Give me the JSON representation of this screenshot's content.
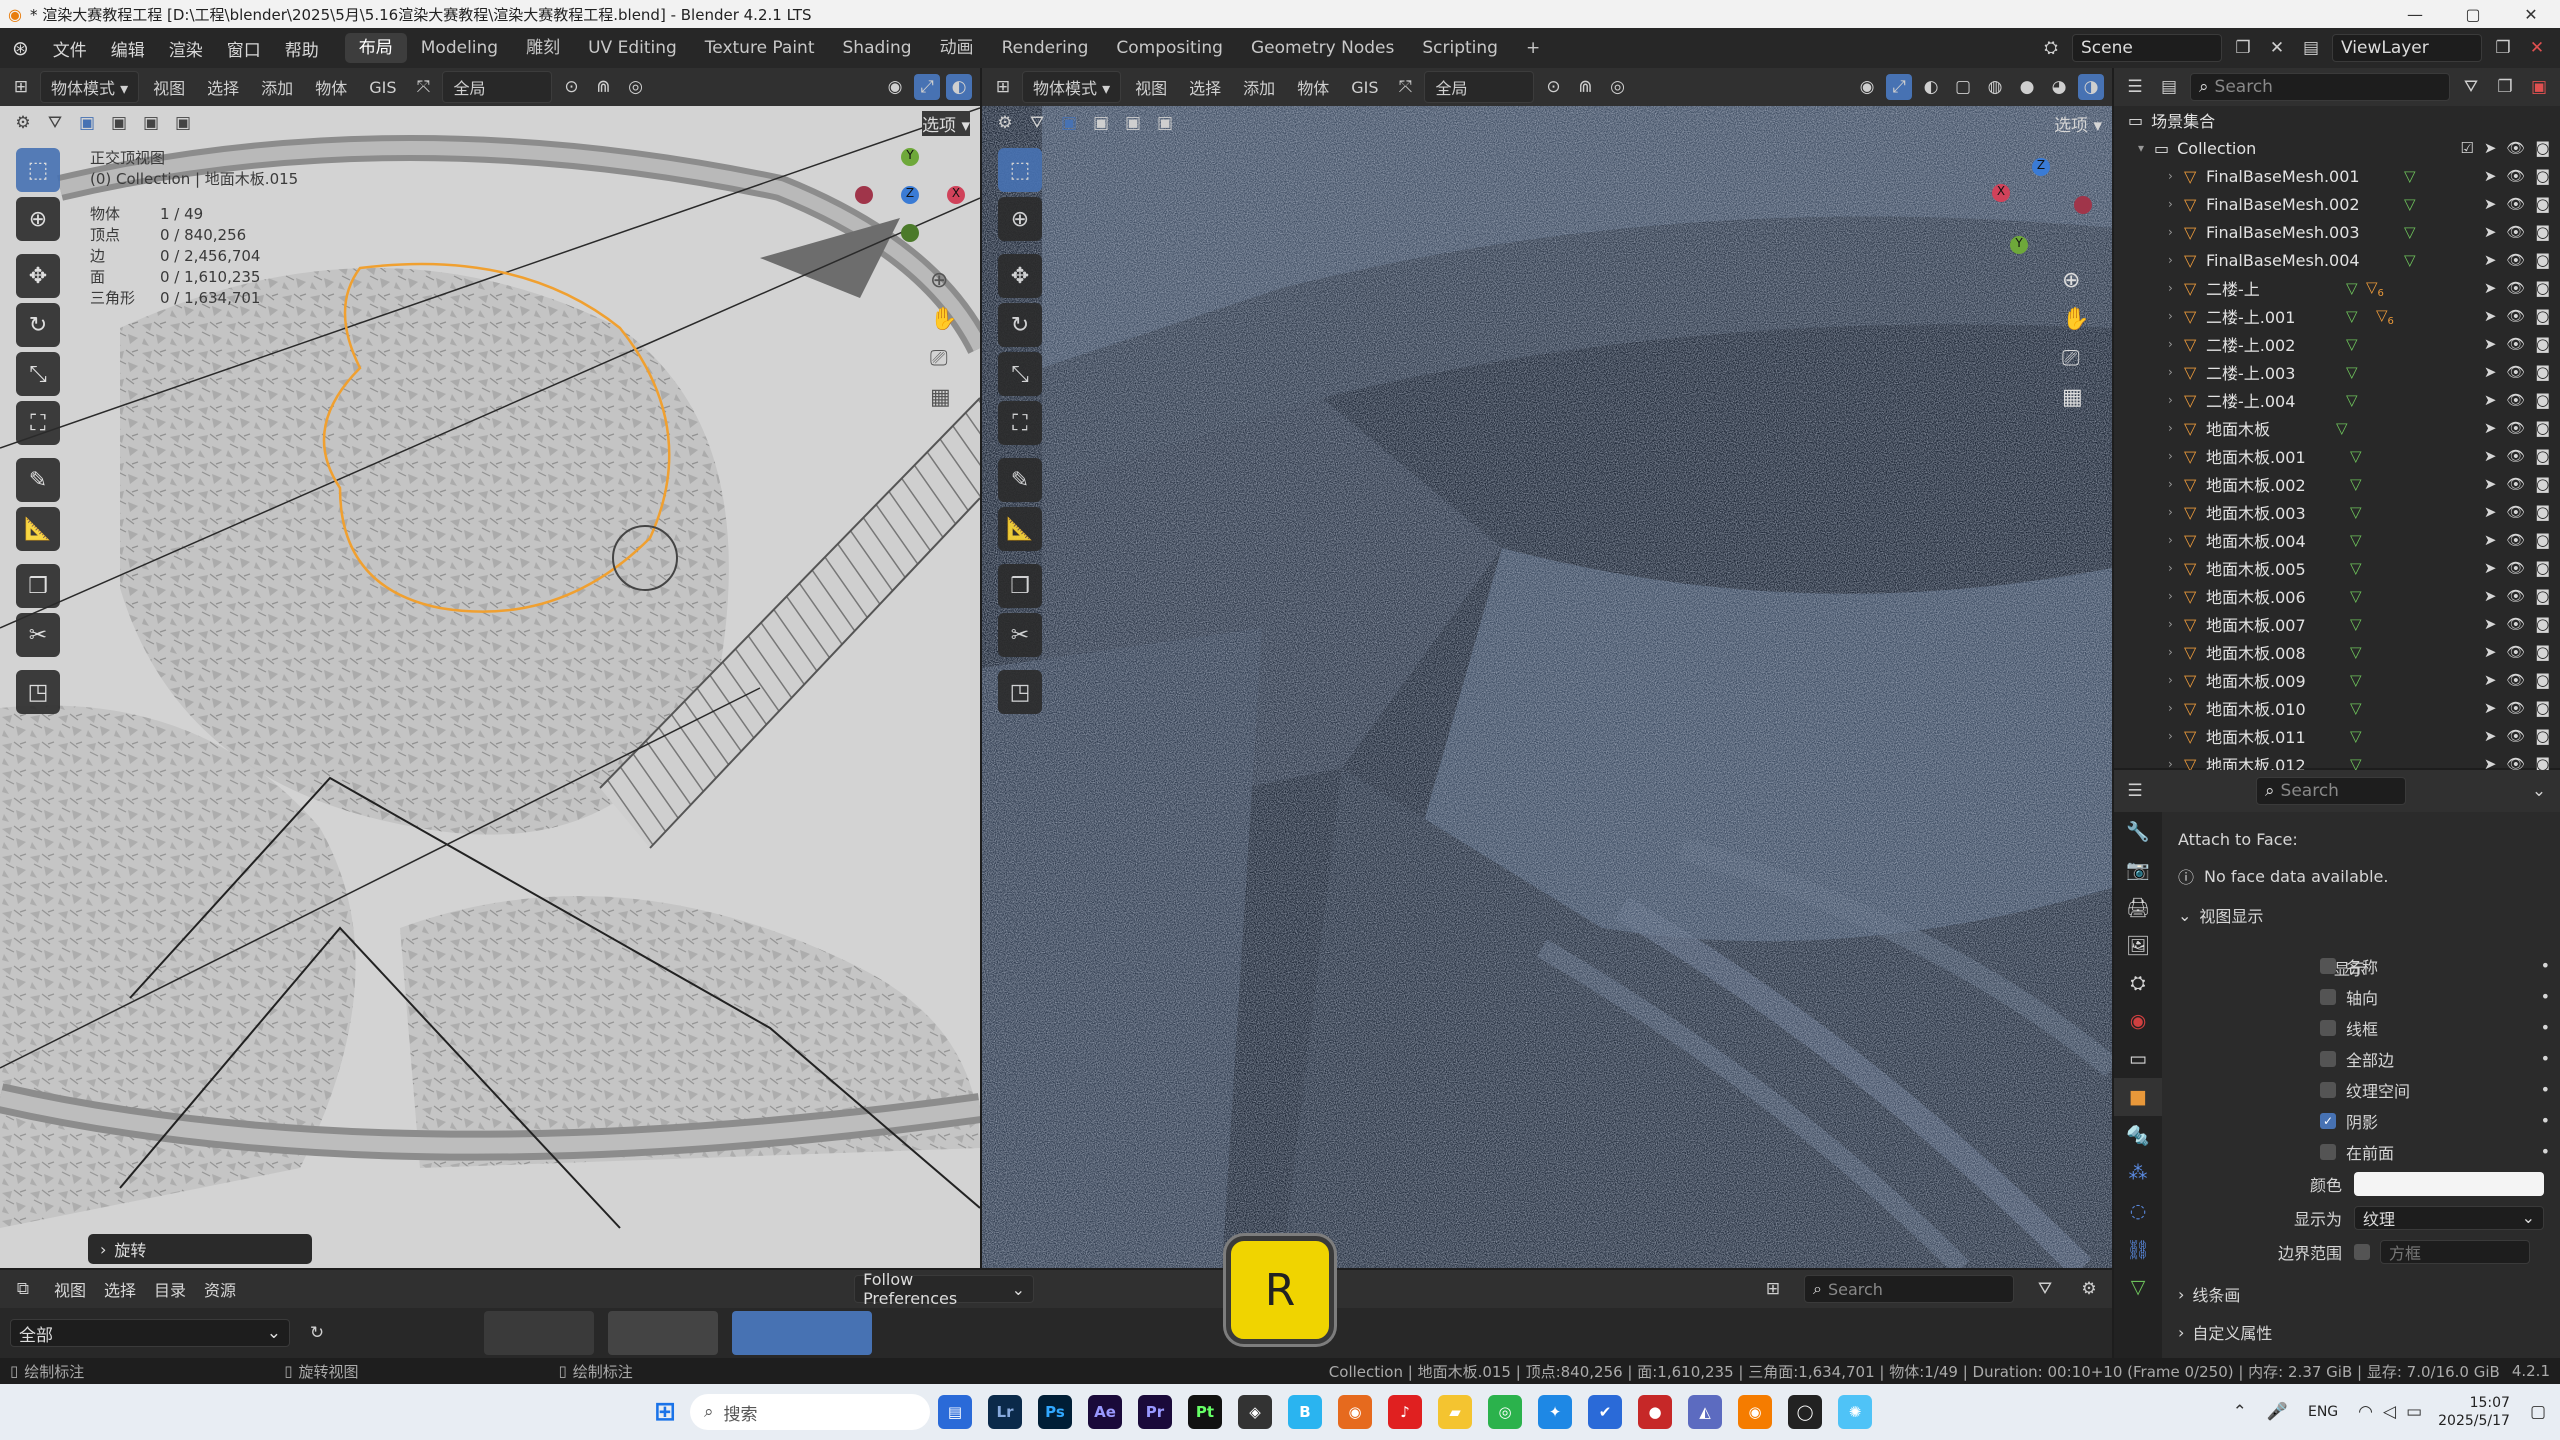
{
  "title_bar": {
    "text": "* 渲染大赛教程工程 [D:\\工程\\blender\\2025\\5月\\5.16渲染大赛教程\\渲染大赛教程工程.blend] - Blender 4.2.1 LTS",
    "min": "—",
    "max": "▢",
    "close": "✕"
  },
  "menubar": {
    "menus": [
      "文件",
      "编辑",
      "渲染",
      "窗口",
      "帮助"
    ],
    "workspaces": [
      "布局",
      "Modeling",
      "雕刻",
      "UV Editing",
      "Texture Paint",
      "Shading",
      "动画",
      "Rendering",
      "Compositing",
      "Geometry Nodes",
      "Scripting"
    ],
    "active_workspace": "布局",
    "add_tab": "+",
    "scene": "Scene",
    "view_layer": "ViewLayer"
  },
  "viewport_left": {
    "mode": "物体模式",
    "menus": [
      "视图",
      "选择",
      "添加",
      "物体",
      "GIS"
    ],
    "orientation": "全局",
    "options": "选项",
    "view_name": "正交顶视图",
    "collection_info": "(0) Collection | 地面木板.015",
    "stats": [
      {
        "label": "物体",
        "value": "1 / 49"
      },
      {
        "label": "顶点",
        "value": "0 / 840,256"
      },
      {
        "label": "边",
        "value": "0 / 2,456,704"
      },
      {
        "label": "面",
        "value": "0 / 1,610,235"
      },
      {
        "label": "三角形",
        "value": "0 / 1,634,701"
      }
    ],
    "last_op": "旋转",
    "axis_y": "Y",
    "axis_z": "Z",
    "axis_x": "X"
  },
  "viewport_right": {
    "mode": "物体模式",
    "menus": [
      "视图",
      "选择",
      "添加",
      "物体",
      "GIS"
    ],
    "orientation": "全局",
    "options": "选项",
    "axis_z": "Z",
    "axis_y": "Y",
    "axis_x": "X"
  },
  "outliner": {
    "search_placeholder": "Search",
    "root": "场景集合",
    "collection": "Collection",
    "items": [
      "FinalBaseMesh.001",
      "FinalBaseMesh.002",
      "FinalBaseMesh.003",
      "FinalBaseMesh.004",
      "二楼-上",
      "二楼-上.001",
      "二楼-上.002",
      "二楼-上.003",
      "二楼-上.004",
      "地面木板",
      "地面木板.001",
      "地面木板.002",
      "地面木板.003",
      "地面木板.004",
      "地面木板.005",
      "地面木板.006",
      "地面木板.007",
      "地面木板.008",
      "地面木板.009",
      "地面木板.010",
      "地面木板.011",
      "地面木板.012"
    ],
    "modifier_badge_4": "6",
    "modifier_badge_5": "6"
  },
  "properties": {
    "search_placeholder": "Search",
    "attach_label": "Attach to Face:",
    "attach_msg": "No face data available.",
    "panel_title": "视图显示",
    "show_label": "显示",
    "checks": [
      {
        "label": "名称",
        "on": false
      },
      {
        "label": "轴向",
        "on": false
      },
      {
        "label": "线框",
        "on": false
      },
      {
        "label": "全部边",
        "on": false
      },
      {
        "label": "纹理空间",
        "on": false
      },
      {
        "label": "阴影",
        "on": true
      },
      {
        "label": "在前面",
        "on": false
      }
    ],
    "color_label": "颜色",
    "display_as_label": "显示为",
    "display_as_value": "纹理",
    "bounds_label": "边界范围",
    "bounds_value": "方框",
    "collapsed": [
      "线条画",
      "自定义属性"
    ]
  },
  "asset_browser": {
    "menus": [
      "视图",
      "选择",
      "目录",
      "资源"
    ],
    "filter_value": "全部",
    "import_method": "Follow Preferences",
    "search_placeholder": "Search"
  },
  "key_overlay": "R",
  "statusbar": {
    "left1": "绘制标注",
    "left2": "旋转视图",
    "left3": "绘制标注",
    "right": "Collection | 地面木板.015 | 顶点:840,256 | 面:1,610,235 | 三角面:1,634,701 | 物体:1/49 | Duration: 00:10+10 (Frame 0/250) | 内存: 2.37 GiB | 显存: 7.0/16.0 GiB",
    "version": "4.2.1"
  },
  "taskbar": {
    "search_placeholder": "搜索",
    "lang": "ENG",
    "time": "15:07",
    "date": "2025/5/17"
  },
  "colors": {
    "accent": "#4772b3",
    "object_orange": "#e8983a",
    "mesh_green": "#6cc05a",
    "key_yellow": "#f0d400"
  }
}
